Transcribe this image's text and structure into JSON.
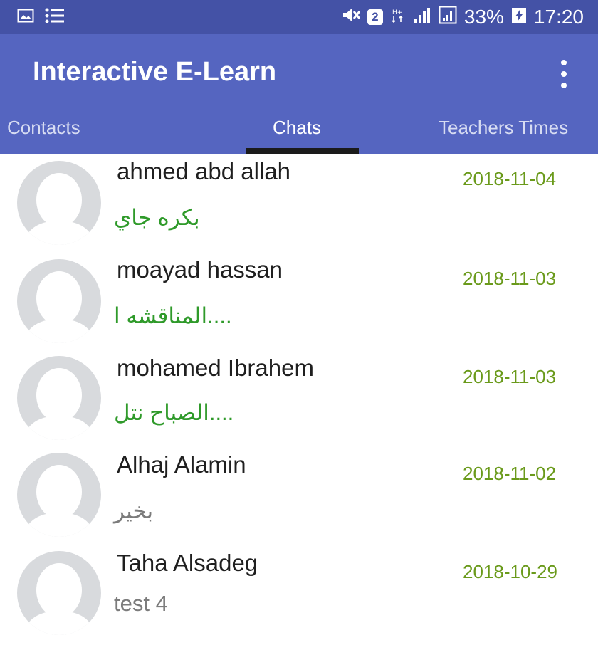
{
  "status_bar": {
    "left_icons": [
      "gallery-icon",
      "notification-list-icon"
    ],
    "right_icons": [
      "mute-icon",
      "sim-2-icon",
      "data-icon",
      "signal-icon",
      "signal-2-icon"
    ],
    "sim_label": "2",
    "battery_percent": "33%",
    "time": "17:20"
  },
  "app_bar": {
    "title": "Interactive E-Learn",
    "menu_icon": "overflow-menu-icon",
    "color": "#5565c0",
    "status_color": "#4452a6"
  },
  "tabs": [
    {
      "label": "Contacts",
      "active": false
    },
    {
      "label": "Chats",
      "active": true
    },
    {
      "label": "Teachers Times",
      "active": false
    }
  ],
  "chats": [
    {
      "name": "ahmed abd allah",
      "message": "بكره جاي",
      "date": "2018-11-04",
      "message_color": "green"
    },
    {
      "name": "moayad hassan",
      "message": "المناقشه ا....",
      "date": "2018-11-03",
      "message_color": "green"
    },
    {
      "name": "mohamed Ibrahem",
      "message": "الصباح نتل....",
      "date": "2018-11-03",
      "message_color": "green"
    },
    {
      "name": "Alhaj Alamin",
      "message": "بخير",
      "date": "2018-11-02",
      "message_color": "gray"
    },
    {
      "name": "Taha Alsadeg",
      "message": "test 4",
      "date": "2018-10-29",
      "message_color": "gray"
    }
  ],
  "colors": {
    "date": "#6a9a1b",
    "green_message": "#2f9a2a",
    "gray_message": "#7c7c7c"
  }
}
